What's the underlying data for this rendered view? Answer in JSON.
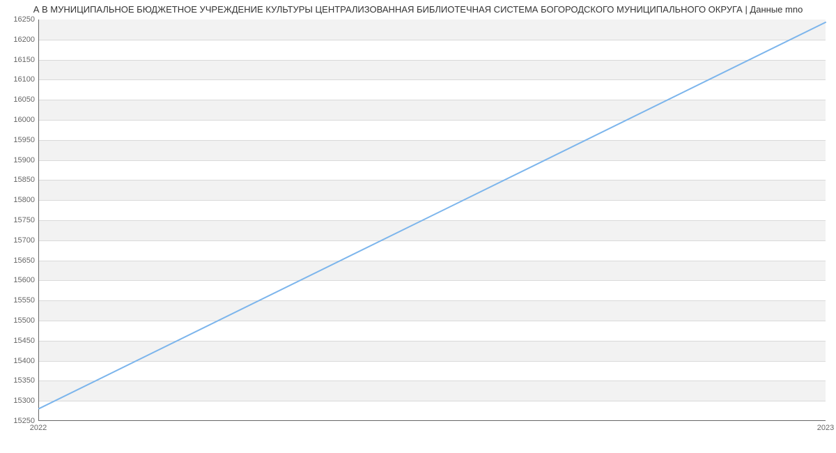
{
  "chart_data": {
    "type": "line",
    "title": "А В МУНИЦИПАЛЬНОЕ БЮДЖЕТНОЕ УЧРЕЖДЕНИЕ КУЛЬТУРЫ ЦЕНТРАЛИЗОВАННАЯ БИБЛИОТЕЧНАЯ СИСТЕМА БОГОРОДСКОГО МУНИЦИПАЛЬНОГО ОКРУГА | Данные mno",
    "xlabel": "",
    "ylabel": "",
    "x": [
      2022,
      2023
    ],
    "values": [
      15279,
      16243
    ],
    "xlim": [
      2022,
      2023
    ],
    "ylim": [
      15250,
      16250
    ],
    "y_ticks": [
      15250,
      15300,
      15350,
      15400,
      15450,
      15500,
      15550,
      15600,
      15650,
      15700,
      15750,
      15800,
      15850,
      15900,
      15950,
      16000,
      16050,
      16100,
      16150,
      16200,
      16250
    ],
    "x_ticks": [
      2022,
      2023
    ],
    "line_color": "#7cb5ec",
    "grid_alt_band_color": "#f2f2f2"
  }
}
